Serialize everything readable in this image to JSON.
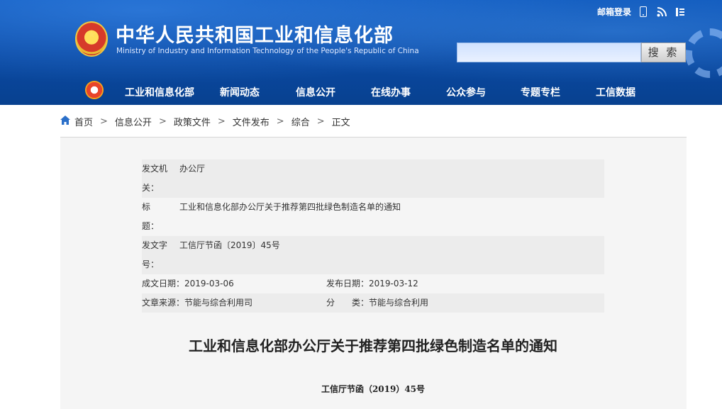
{
  "header": {
    "title_cn": "中华人民共和国工业和信息化部",
    "title_en": "Ministry of Industry and Information Technology of the People's Republic of China",
    "mail_login": "邮箱登录",
    "search_button": "搜 索",
    "search_placeholder": ""
  },
  "nav": {
    "items": [
      "工业和信息化部",
      "新闻动态",
      "信息公开",
      "在线办事",
      "公众参与",
      "专题专栏",
      "工信数据"
    ]
  },
  "breadcrumb": {
    "items": [
      "首页",
      "信息公开",
      "政策文件",
      "文件发布",
      "综合",
      "正文"
    ],
    "separator": ">"
  },
  "meta": {
    "issuer_label": "发文机关：",
    "issuer_value": "办公厅",
    "title_label": "标　　题：",
    "title_value": "工业和信息化部办公厅关于推荐第四批绿色制造名单的通知",
    "docno_label": "发文字号：",
    "docno_value": "工信厅节函〔2019〕45号",
    "created": "成文日期：2019-03-06",
    "published": "发布日期：2019-03-12",
    "source": "文章来源：节能与综合利用司",
    "category": "分　　类：节能与综合利用"
  },
  "document": {
    "title": "工业和信息化部办公厅关于推荐第四批绿色制造名单的通知",
    "number": "工信厅节函（2019）45号"
  },
  "colors": {
    "header_blue": "#0a4aa6",
    "link_blue": "#2a6fc9",
    "meta_bg": "#ececec"
  }
}
